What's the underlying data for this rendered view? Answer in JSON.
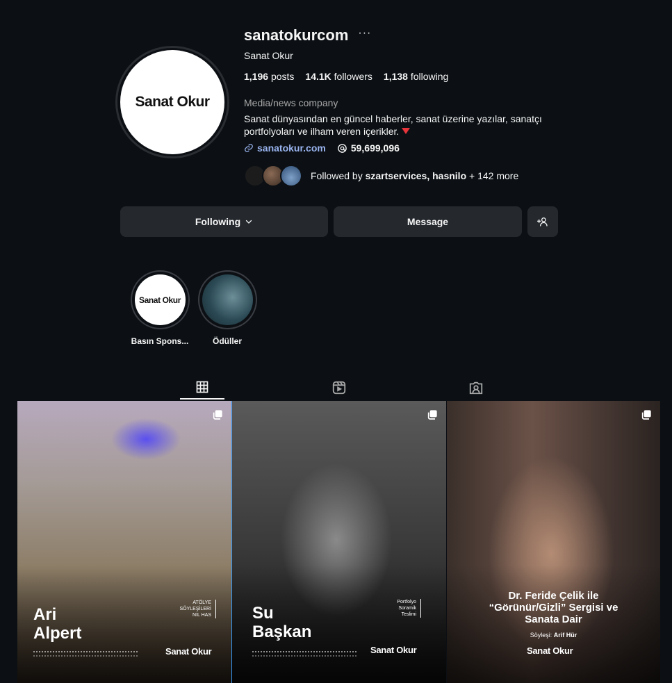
{
  "profile": {
    "username": "sanatokurcom",
    "more_glyph": "···",
    "full_name": "Sanat Okur",
    "avatar_logo": "Sanat Okur",
    "stats": {
      "posts_count": "1,196",
      "posts_label": "posts",
      "followers_count": "14.1K",
      "followers_label": "followers",
      "following_count": "1,138",
      "following_label": "following"
    },
    "category": "Media/news company",
    "bio": "Sanat dünyasından en güncel haberler, sanat üzerine yazılar, sanatçı portfolyoları ve ilham veren içerikler.",
    "link_text": "sanatokur.com",
    "threads_count": "59,699,096",
    "followed_by_prefix": "Followed by",
    "followed_by_names": "szartservices, hasnilo",
    "followed_by_suffix": "+ 142 more"
  },
  "actions": {
    "following_label": "Following",
    "message_label": "Message"
  },
  "highlights": [
    {
      "label": "Basın Spons...",
      "logo": "Sanat Okur"
    },
    {
      "label": "Ödüller"
    }
  ],
  "tabs": [
    "posts-grid",
    "reels",
    "tagged"
  ],
  "posts": [
    {
      "name": "Ari\nAlpert",
      "tag": "ATÖLYE\nSÖYLEŞİLERİ\nNİL HAS",
      "brand": "Sanat Okur"
    },
    {
      "name": "Su\nBaşkan",
      "tag": "Portfolyo\nSoramik\nTeslimi",
      "brand": "Sanat Okur"
    },
    {
      "title": "Dr. Feride Çelik ile\n“Görünür/Gizli” Sergisi ve\nSanata Dair",
      "sub_prefix": "Söyleşi:",
      "sub_name": "Arif Hür",
      "brand": "Sanat Okur"
    }
  ],
  "colors": {
    "background": "#0c1014",
    "button": "#25292e",
    "link": "#9ab4f0",
    "muted": "#a8a8a8"
  }
}
